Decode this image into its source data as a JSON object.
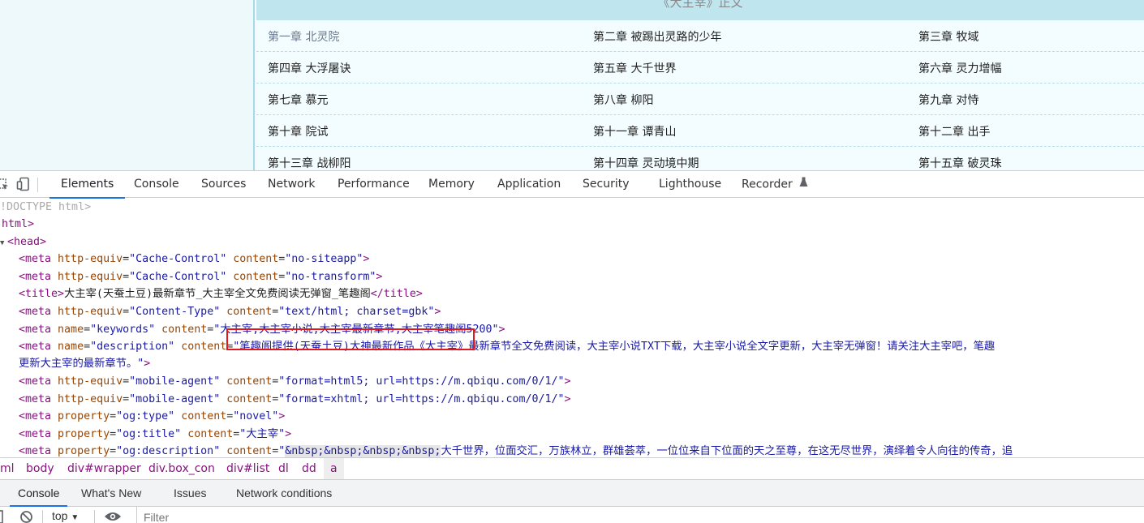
{
  "page": {
    "volume_title": "《大主宰》正文",
    "chapters": [
      [
        "第一章  北灵院",
        "第二章  被踢出灵路的少年",
        "第三章  牧域"
      ],
      [
        "第四章  大浮屠诀",
        "第五章  大千世界",
        "第六章  灵力增幅"
      ],
      [
        "第七章  慕元",
        "第八章  柳阳",
        "第九章  对恃"
      ],
      [
        "第十章  院试",
        "第十一章  谭青山",
        "第十二章  出手"
      ],
      [
        "第十三章  战柳阳",
        "第十四章  灵动境中期",
        "第十五章  破灵珠"
      ]
    ]
  },
  "devtools": {
    "tabs": [
      "Elements",
      "Console",
      "Sources",
      "Network",
      "Performance",
      "Memory",
      "Application",
      "Security",
      "Lighthouse",
      "Recorder"
    ],
    "active_tab": "Elements",
    "accent_color": "#1a73e8",
    "icons": [
      "inspect-icon",
      "device-toggle-icon",
      "flask-icon"
    ],
    "dom": {
      "doctype": "!DOCTYPE html>",
      "html_open": "html>",
      "head_open": "<head>",
      "meta1": {
        "tag": "<meta",
        "attr1": "http-equiv",
        "val1": "\"Cache-Control\"",
        "attr2": "content",
        "val2": "\"no-siteapp\"",
        "close": ">"
      },
      "meta2": {
        "tag": "<meta",
        "attr1": "http-equiv",
        "val1": "\"Cache-Control\"",
        "attr2": "content",
        "val2": "\"no-transform\"",
        "close": ">"
      },
      "title": {
        "open": "<title>",
        "text": "大主宰(天蚕土豆)最新章节_大主宰全文免费阅读无弹窗_笔趣阁",
        "close": "</title>"
      },
      "meta3": {
        "tag": "<meta",
        "attr1": "http-equiv",
        "val1": "\"Content-Type\"",
        "attr2": "content",
        "val2": "\"text/html; charset=gbk\"",
        "close": ">"
      },
      "meta4": {
        "tag": "<meta",
        "attr1": "name",
        "val1": "\"keywords\"",
        "attr2": "content",
        "val2": "\"大主宰,大主宰小说,大主宰最新章节,大主宰笔趣阁5200\"",
        "close": ">"
      },
      "meta5": {
        "tag": "<meta",
        "attr1": "name",
        "val1": "\"description\"",
        "attr2": "content",
        "val2": "\"笔趣阁提供(天蚕土豆)大神最新作品《大主宰》最新章节全文免费阅读，大主宰小说TXT下载，大主宰小说全文字更新，大主宰无弹窗！请关注大主宰吧，笔趣",
        "val2_cont": "更新大主宰的最新章节。\"",
        "close": ">"
      },
      "meta6": {
        "tag": "<meta",
        "attr1": "http-equiv",
        "val1": "\"mobile-agent\"",
        "attr2": "content",
        "val2": "\"format=html5; url=https://m.qbiqu.com/0/1/\"",
        "close": ">"
      },
      "meta7": {
        "tag": "<meta",
        "attr1": "http-equiv",
        "val1": "\"mobile-agent\"",
        "attr2": "content",
        "val2": "\"format=xhtml; url=https://m.qbiqu.com/0/1/\"",
        "close": ">"
      },
      "meta8": {
        "tag": "<meta",
        "attr1": "property",
        "val1": "\"og:type\"",
        "attr2": "content",
        "val2": "\"novel\"",
        "close": ">"
      },
      "meta9": {
        "tag": "<meta",
        "attr1": "property",
        "val1": "\"og:title\"",
        "attr2": "content",
        "val2": "\"大主宰\"",
        "close": ">"
      },
      "meta10": {
        "tag": "<meta",
        "attr1": "property",
        "val1": "\"og:description\"",
        "attr2": "content",
        "val2_q": "\"",
        "val2_hl": "&nbsp;&nbsp;&nbsp;&nbsp;",
        "val2": "大千世界，位面交汇，万族林立，群雄荟萃，一位位来自下位面的天之至尊，在这无尽世界，演绎着令人向往的传奇，追"
      }
    },
    "breadcrumb": [
      "ml",
      "body",
      "div#wrapper",
      "div.box_con",
      "div#list",
      "dl",
      "dd",
      "a"
    ],
    "drawer_tabs": [
      "Console",
      "What's New",
      "Issues",
      "Network conditions"
    ],
    "console": {
      "context": "top",
      "filter_placeholder": "Filter"
    }
  }
}
